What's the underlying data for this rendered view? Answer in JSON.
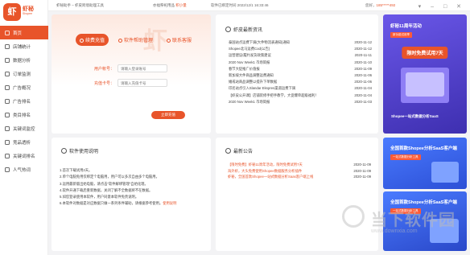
{
  "app": {
    "name": "虾秘",
    "sub": "Shopee",
    "logo_char": "虾",
    "brand_color": "#e8542a"
  },
  "topbar": {
    "version_text": "虾秘助手 – 虾皮跨境助理工具",
    "shop_text": "亦福祭祀用品",
    "shop_status": "积小量",
    "time_text": "软件已绑定时间 2022/12/1 16:33:46",
    "user_label": "您好，",
    "user_value": "185*****492",
    "window_controls": "▾ – □ ✕"
  },
  "sidebar": {
    "items": [
      {
        "label": "首页",
        "icon": "home-icon",
        "active": true
      },
      {
        "label": "店铺统计",
        "icon": "store-icon"
      },
      {
        "label": "数据分析",
        "icon": "chart-icon"
      },
      {
        "label": "订单监测",
        "icon": "order-icon"
      },
      {
        "label": "广告概况",
        "icon": "ad-icon"
      },
      {
        "label": "广告排名",
        "icon": "rank-icon"
      },
      {
        "label": "类目排名",
        "icon": "category-icon"
      },
      {
        "label": "关键词监控",
        "icon": "keyword-icon"
      },
      {
        "label": "竞品透析",
        "icon": "compare-icon"
      },
      {
        "label": "关键词排名",
        "icon": "ranking-icon"
      },
      {
        "label": "人气热词",
        "icon": "fire-icon"
      }
    ]
  },
  "login": {
    "tabs": [
      "续费充值",
      "软件帮助管理",
      "联系客服"
    ],
    "deco_text": "虾",
    "account_label": "用户帐号：",
    "account_placeholder": "请输入登录账号",
    "password_label": "充值卡号：",
    "password_placeholder": "请输入充值卡号",
    "submit_label": "立即充值"
  },
  "news": {
    "title": "虾皮最新资讯",
    "items": [
      {
        "text": "泰国站点运费下调(大件物流表通知)通知",
        "date": "2020-11-12"
      },
      {
        "text": "Shopee北马运费Cod(公告)",
        "date": "2020-11-12"
      },
      {
        "text": "运营建议/履约发货政策建议",
        "date": "2020-11-11"
      },
      {
        "text": "2020 Nov Week1 市场简报",
        "date": "2020-11-10"
      },
      {
        "text": "春节大促推广价值报",
        "date": "2020-11-09"
      },
      {
        "text": "新加坡大件商品调整运费通知",
        "date": "2020-11-06"
      },
      {
        "text": "婚戒站商品调整以提升下单数据",
        "date": "2020-11-06"
      },
      {
        "text": "印尼站点引入Slandar Ekspres渠道运费下调",
        "date": "2020-11-04"
      },
      {
        "text": "【虾皮公开课】店铺装修手把手教学，大促爆单超级福利！",
        "date": "2020-11-04"
      },
      {
        "text": "2020 Nov Week1 市场简报",
        "date": "2020-11-03"
      }
    ]
  },
  "usage": {
    "title": "软件使用说明",
    "lines": [
      "1.首次下载试用2天。",
      "2.单个电脑免用仅绑定个电脑用，用户可以多次自由多个电脑用。",
      "3.运用最新版出始电脑，请点击\"软件解绑管理\"自始化理。",
      "4.软件开通下载后重新数据，关闭了解不全数据将不在数据。",
      "5.如您登录使用本软件，用户同意本软件免责说明。",
      "6.本软件对数据是对应数据只做一系列条件辅助，请根据参考使用。"
    ],
    "link_text": "使用说明"
  },
  "announcements": {
    "title": "最新公告",
    "items": [
      {
        "text": "【限时免费】虾秘11周年活动，限时免费试用7天",
        "date": "2020-11-09"
      },
      {
        "text": "海外虾，大头免费使用Shopee数据服务分析插件",
        "date": "2020-11-09"
      },
      {
        "text": "虾秘，全国首款Shopee一站式数据分析Saas客户端上线",
        "date": "2020-11-09"
      }
    ]
  },
  "ads": [
    {
      "title": "虾秘11周年活动",
      "tag": "新功能试用享",
      "pill": "限时免费试用7天"
    },
    {
      "title": "全国首款Shopee分析SaaS客户端",
      "tag": "一站式数据分析工具"
    },
    {
      "title": "全国首款Shopee分析SaaS客户端",
      "tag": "一站式数据分析工具"
    }
  ],
  "ad_mid_text": "Shopee一站式数据分析SaaS",
  "watermark": {
    "title": "当下软件园",
    "url": "www.downxia.com"
  }
}
